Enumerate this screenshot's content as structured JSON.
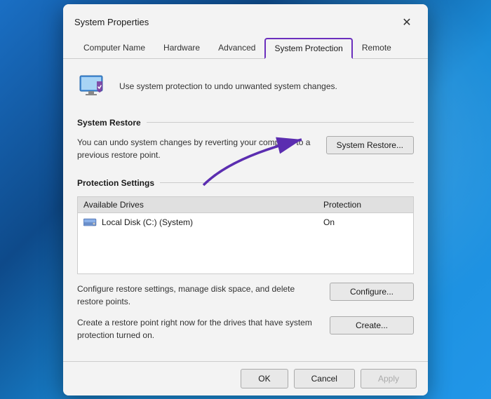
{
  "dialog": {
    "title": "System Properties",
    "close_label": "✕"
  },
  "tabs": {
    "items": [
      {
        "id": "computer-name",
        "label": "Computer Name",
        "active": false
      },
      {
        "id": "hardware",
        "label": "Hardware",
        "active": false
      },
      {
        "id": "advanced",
        "label": "Advanced",
        "active": false
      },
      {
        "id": "system-protection",
        "label": "System Protection",
        "active": true
      },
      {
        "id": "remote",
        "label": "Remote",
        "active": false
      }
    ]
  },
  "header": {
    "description": "Use system protection to undo unwanted system changes."
  },
  "system_restore": {
    "section_label": "System Restore",
    "description": "You can undo system changes by reverting\nyour computer to a previous restore point.",
    "button_label": "System Restore..."
  },
  "protection_settings": {
    "section_label": "Protection Settings",
    "col_drives": "Available Drives",
    "col_protection": "Protection",
    "drives": [
      {
        "name": "Local Disk (C:) (System)",
        "protection": "On"
      }
    ],
    "configure_desc": "Configure restore settings, manage disk space, and\ndelete restore points.",
    "configure_label": "Configure...",
    "create_desc": "Create a restore point right now for the drives that\nhave system protection turned on.",
    "create_label": "Create..."
  },
  "footer": {
    "ok_label": "OK",
    "cancel_label": "Cancel",
    "apply_label": "Apply"
  }
}
